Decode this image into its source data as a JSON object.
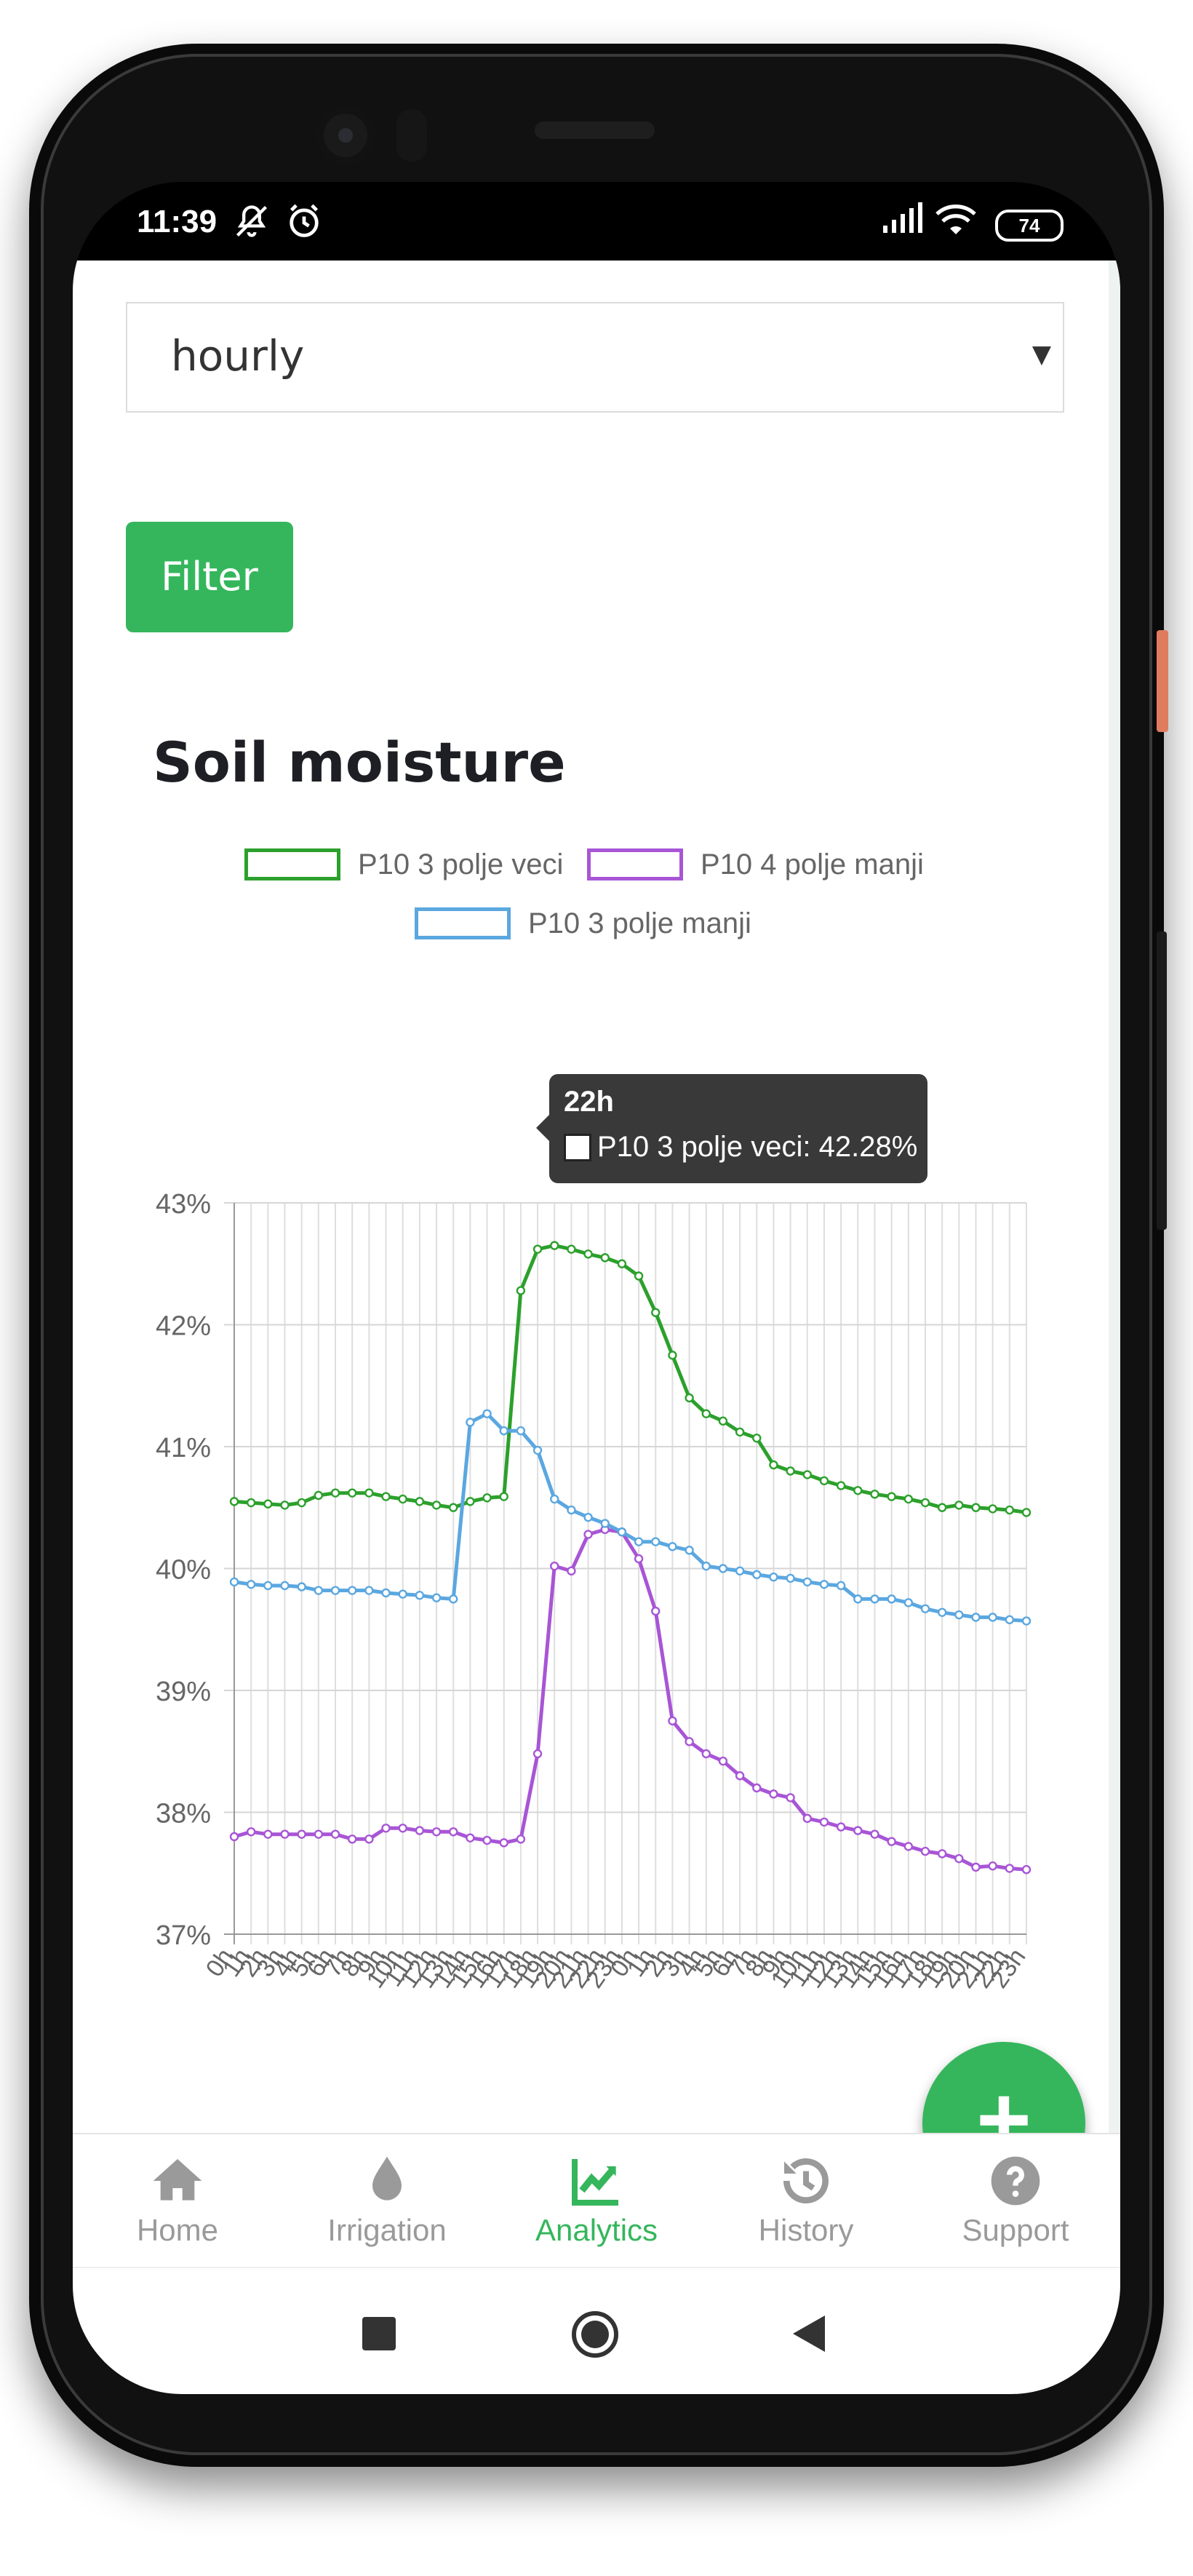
{
  "status_bar": {
    "time": "11:39",
    "battery": "74"
  },
  "filter": {
    "interval_value": "hourly",
    "button_label": "Filter"
  },
  "chart_data": {
    "type": "line",
    "title": "Soil moisture",
    "y_tick_labels": [
      "43%",
      "42%",
      "41%",
      "40%",
      "39%",
      "38%",
      "37%"
    ],
    "ylim": [
      37,
      43
    ],
    "grid": true,
    "legend_position": "top",
    "x": [
      "0h",
      "1h",
      "2h",
      "3h",
      "4h",
      "5h",
      "6h",
      "7h",
      "8h",
      "9h",
      "10h",
      "11h",
      "12h",
      "13h",
      "14h",
      "15h",
      "16h",
      "17h",
      "18h",
      "19h",
      "20h",
      "21h",
      "22h",
      "23h",
      "0h",
      "1h",
      "2h",
      "3h",
      "4h",
      "5h",
      "6h",
      "7h",
      "8h",
      "9h",
      "10h",
      "11h",
      "12h",
      "13h",
      "14h",
      "15h",
      "16h",
      "17h",
      "18h",
      "19h",
      "20h",
      "21h",
      "22h",
      "23h"
    ],
    "series": [
      {
        "name": "P10 3 polje veci",
        "color": "#2ca02c",
        "values": [
          40.55,
          40.54,
          40.53,
          40.52,
          40.54,
          40.6,
          40.62,
          40.62,
          40.62,
          40.59,
          40.57,
          40.55,
          40.52,
          40.5,
          40.55,
          40.58,
          40.59,
          42.28,
          42.62,
          42.65,
          42.62,
          42.58,
          42.55,
          42.5,
          42.4,
          42.1,
          41.75,
          41.4,
          41.27,
          41.21,
          41.12,
          41.07,
          40.85,
          40.8,
          40.77,
          40.72,
          40.68,
          40.64,
          40.61,
          40.59,
          40.57,
          40.54,
          40.5,
          40.52,
          40.5,
          40.49,
          40.48,
          40.46
        ]
      },
      {
        "name": "P10 4 polje manji",
        "color": "#a855d6",
        "values": [
          37.8,
          37.84,
          37.82,
          37.82,
          37.82,
          37.82,
          37.82,
          37.78,
          37.78,
          37.87,
          37.87,
          37.85,
          37.84,
          37.84,
          37.79,
          37.77,
          37.75,
          37.78,
          38.48,
          40.02,
          39.98,
          40.28,
          40.32,
          40.3,
          40.08,
          39.65,
          38.75,
          38.58,
          38.48,
          38.42,
          38.3,
          38.2,
          38.15,
          38.12,
          37.95,
          37.92,
          37.88,
          37.85,
          37.82,
          37.76,
          37.72,
          37.68,
          37.66,
          37.62,
          37.55,
          37.56,
          37.54,
          37.53
        ]
      },
      {
        "name": "P10 3 polje manji",
        "color": "#5ba7e0",
        "values": [
          39.89,
          39.87,
          39.86,
          39.86,
          39.85,
          39.82,
          39.82,
          39.82,
          39.82,
          39.8,
          39.79,
          39.78,
          39.76,
          39.75,
          41.2,
          41.27,
          41.13,
          41.13,
          40.97,
          40.57,
          40.48,
          40.42,
          40.37,
          40.3,
          40.22,
          40.22,
          40.18,
          40.15,
          40.02,
          40.0,
          39.98,
          39.95,
          39.93,
          39.92,
          39.89,
          39.87,
          39.86,
          39.75,
          39.75,
          39.75,
          39.72,
          39.67,
          39.64,
          39.62,
          39.6,
          39.6,
          39.58,
          39.57
        ]
      }
    ],
    "tooltip": {
      "title": "22h",
      "text": "P10 3 polje veci: 42.28%"
    }
  },
  "nav": {
    "items": [
      {
        "label": "Home",
        "icon": "home-icon"
      },
      {
        "label": "Irrigation",
        "icon": "water-drop-icon"
      },
      {
        "label": "Analytics",
        "icon": "chart-line-icon"
      },
      {
        "label": "History",
        "icon": "history-icon"
      },
      {
        "label": "Support",
        "icon": "help-icon"
      }
    ],
    "active": "Analytics"
  },
  "colors": {
    "accent": "#35b65c"
  }
}
